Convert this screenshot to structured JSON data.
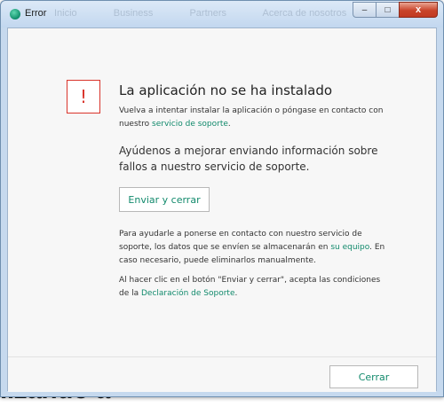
{
  "background": {
    "heading_fragment": "lizando a"
  },
  "window": {
    "title": "Error",
    "ghost_tabs": [
      "Inicio",
      "Business",
      "Partners",
      "Acerca de nosotros"
    ],
    "controls": {
      "minimize": "–",
      "maximize": "□",
      "close": "x"
    }
  },
  "dialog": {
    "alert_glyph": "!",
    "heading": "La aplicación no se ha instalado",
    "intro_text": "Vuelva a intentar instalar la aplicación o póngase en contacto con nuestro ",
    "intro_link": "servicio de soporte",
    "intro_end": ".",
    "help_text": "Ayúdenos a mejorar enviando información sobre fallos a nuestro servicio de soporte.",
    "send_button": "Enviar y cerrar",
    "data_text": "Para ayudarle a ponerse en contacto con nuestro servicio de soporte, los datos que se envíen se almacenarán en ",
    "data_link": "su equipo",
    "data_end": ". En caso necesario, puede eliminarlos manualmente.",
    "terms_text": "Al hacer clic en el botón \"Enviar y cerrar\", acepta las condiciones de la ",
    "terms_link": "Declaración de Soporte",
    "terms_end": ".",
    "close_button": "Cerrar"
  },
  "colors": {
    "accent_link": "#128a6c",
    "alert_red": "#d9342b",
    "titlebar": "#c6d9ee"
  }
}
